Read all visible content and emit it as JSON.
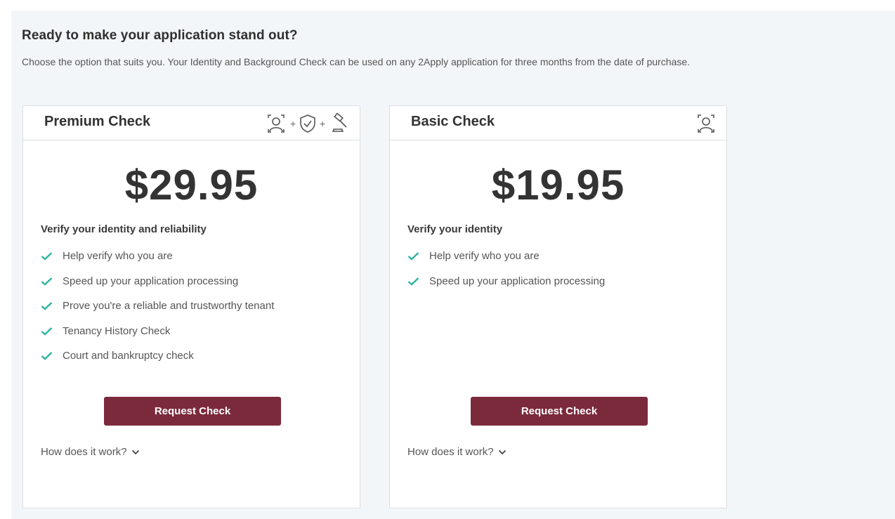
{
  "heading": "Ready to make your application stand out?",
  "subtext": "Choose the option that suits you. Your Identity and Background Check can be used on any 2Apply application for three months from the date of purchase.",
  "colors": {
    "button": "#7b2a3c",
    "check": "#2bb3a3",
    "panel": "#f3f6f9"
  },
  "cards": [
    {
      "title": "Premium Check",
      "icons": [
        "id-badge-icon",
        "shield-check-icon",
        "gavel-icon"
      ],
      "plus": "+",
      "price": "$29.95",
      "feature_title": "Verify your identity and reliability",
      "features": [
        "Help verify who you are",
        "Speed up your application processing",
        "Prove you're a reliable and trustworthy tenant",
        "Tenancy History Check",
        "Court and bankruptcy check"
      ],
      "button": "Request Check",
      "how": "How does it work?"
    },
    {
      "title": "Basic Check",
      "icons": [
        "id-badge-icon"
      ],
      "price": "$19.95",
      "feature_title": "Verify your identity",
      "features": [
        "Help verify who you are",
        "Speed up your application processing"
      ],
      "button": "Request Check",
      "how": "How does it work?"
    }
  ]
}
